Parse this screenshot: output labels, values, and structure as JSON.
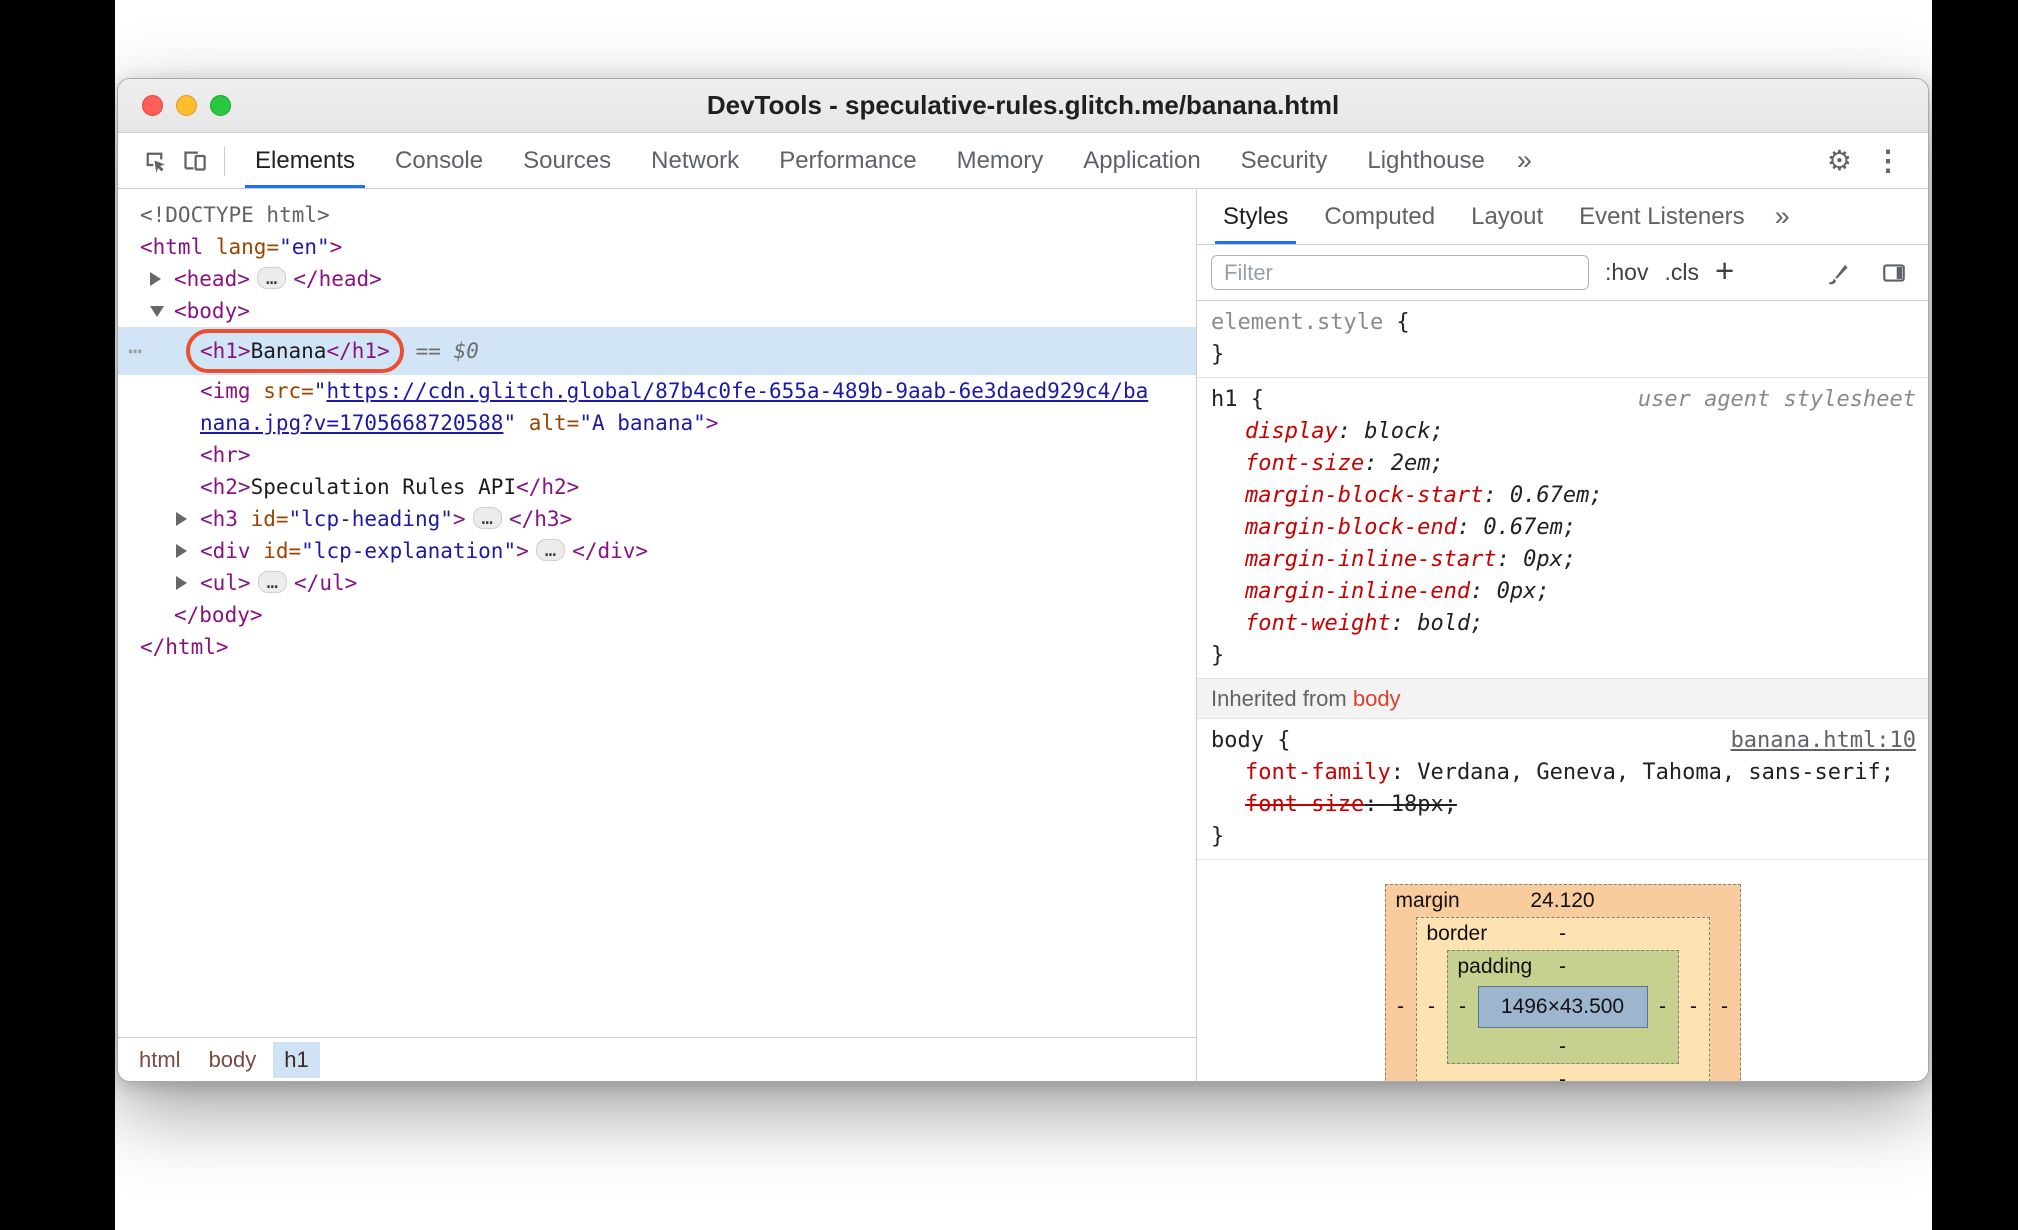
{
  "window": {
    "title": "DevTools - speculative-rules.glitch.me/banana.html"
  },
  "main_toolbar": {
    "tabs": [
      "Elements",
      "Console",
      "Sources",
      "Network",
      "Performance",
      "Memory",
      "Application",
      "Security",
      "Lighthouse"
    ],
    "more_tabs_glyph": "»",
    "gear_glyph": "⚙",
    "menu_glyph": "⋮"
  },
  "dom_tree": {
    "gutter_dots": "⋯",
    "rows": {
      "doctype": [
        {
          "c": "doctype",
          "x": "<!DOCTYPE html>"
        }
      ],
      "html_open": [
        {
          "c": "tag",
          "x": "<html"
        },
        {
          "c": "attr",
          "x": " lang="
        },
        {
          "c": "val",
          "x": "\"en\""
        },
        {
          "c": "tag",
          "x": ">"
        }
      ],
      "head": [
        {
          "c": "tag",
          "x": "<head>"
        },
        {
          "c": "pill",
          "x": "…"
        },
        {
          "c": "tag",
          "x": "</head>"
        }
      ],
      "body_open": [
        {
          "c": "tag",
          "x": "<body>"
        }
      ],
      "h1": [
        {
          "c": "tag",
          "x": "<h1>"
        },
        {
          "c": "text",
          "x": "Banana"
        },
        {
          "c": "tag",
          "x": "</h1>"
        }
      ],
      "h1_badge": "== $0",
      "img": [
        {
          "c": "tag",
          "x": "<img "
        },
        {
          "c": "attr",
          "x": "src="
        },
        {
          "c": "val",
          "x": "\""
        },
        {
          "c": "link",
          "x": "https://cdn.glitch.global/87b4c0fe-655a-489b-9aab-6e3daed929c4/ba"
        },
        {
          "c": "br",
          "x": ""
        },
        {
          "c": "link",
          "x": "nana.jpg?v=1705668720588"
        },
        {
          "c": "val",
          "x": "\""
        },
        {
          "c": "attr",
          "x": " alt="
        },
        {
          "c": "val",
          "x": "\"A banana\""
        },
        {
          "c": "tag",
          "x": ">"
        }
      ],
      "hr": [
        {
          "c": "tag",
          "x": "<hr>"
        }
      ],
      "h2": [
        {
          "c": "tag",
          "x": "<h2>"
        },
        {
          "c": "text",
          "x": "Speculation Rules API"
        },
        {
          "c": "tag",
          "x": "</h2>"
        }
      ],
      "h3": [
        {
          "c": "tag",
          "x": "<h3"
        },
        {
          "c": "attr",
          "x": " id="
        },
        {
          "c": "val",
          "x": "\"lcp-heading\""
        },
        {
          "c": "tag",
          "x": ">"
        },
        {
          "c": "pill",
          "x": "…"
        },
        {
          "c": "tag",
          "x": "</h3>"
        }
      ],
      "div": [
        {
          "c": "tag",
          "x": "<div"
        },
        {
          "c": "attr",
          "x": " id="
        },
        {
          "c": "val",
          "x": "\"lcp-explanation\""
        },
        {
          "c": "tag",
          "x": ">"
        },
        {
          "c": "pill",
          "x": "…"
        },
        {
          "c": "tag",
          "x": "</div>"
        }
      ],
      "ul": [
        {
          "c": "tag",
          "x": "<ul>"
        },
        {
          "c": "pill",
          "x": "…"
        },
        {
          "c": "tag",
          "x": "</ul>"
        }
      ],
      "body_close": [
        {
          "c": "tag",
          "x": "</body>"
        }
      ],
      "html_close": [
        {
          "c": "tag",
          "x": "</html>"
        }
      ]
    },
    "breadcrumbs": [
      "html",
      "body",
      "h1"
    ]
  },
  "styles_panel": {
    "tabs": [
      "Styles",
      "Computed",
      "Layout",
      "Event Listeners"
    ],
    "more_tabs_glyph": "»",
    "filter_placeholder": "Filter",
    "pseudo_toggle": ":hov",
    "class_toggle": ".cls",
    "plus_glyph": "+",
    "element_style": {
      "open": [
        {
          "c": "sel-gray",
          "x": "element.style"
        },
        {
          "c": "plain",
          "x": " {"
        }
      ],
      "close": "}"
    },
    "h1_rule": {
      "open": [
        {
          "c": "plain",
          "x": "h1 {"
        }
      ],
      "origin": "user agent stylesheet",
      "lines": [
        [
          {
            "c": "prop",
            "x": "display"
          },
          {
            "c": "plain",
            "x": ": "
          },
          {
            "c": "pval",
            "x": "block;"
          }
        ],
        [
          {
            "c": "prop",
            "x": "font-size"
          },
          {
            "c": "plain",
            "x": ": "
          },
          {
            "c": "pval",
            "x": "2em;"
          }
        ],
        [
          {
            "c": "prop",
            "x": "margin-block-start"
          },
          {
            "c": "plain",
            "x": ": "
          },
          {
            "c": "pval",
            "x": "0.67em;"
          }
        ],
        [
          {
            "c": "prop",
            "x": "margin-block-end"
          },
          {
            "c": "plain",
            "x": ": "
          },
          {
            "c": "pval",
            "x": "0.67em;"
          }
        ],
        [
          {
            "c": "prop",
            "x": "margin-inline-start"
          },
          {
            "c": "plain",
            "x": ": "
          },
          {
            "c": "pval",
            "x": "0px;"
          }
        ],
        [
          {
            "c": "prop",
            "x": "margin-inline-end"
          },
          {
            "c": "plain",
            "x": ": "
          },
          {
            "c": "pval",
            "x": "0px;"
          }
        ],
        [
          {
            "c": "prop",
            "x": "font-weight"
          },
          {
            "c": "plain",
            "x": ": "
          },
          {
            "c": "pval",
            "x": "bold;"
          }
        ]
      ],
      "close": "}"
    },
    "inherited_from": {
      "prefix": "Inherited from ",
      "node": "body"
    },
    "body_rule": {
      "open": [
        {
          "c": "plain",
          "x": "body {"
        }
      ],
      "source_link": "banana.html:10",
      "lines": [
        [
          {
            "c": "prop",
            "x": "font-family"
          },
          {
            "c": "plain",
            "x": ": "
          },
          {
            "c": "pval",
            "x": "Verdana, Geneva, Tahoma, sans-serif;"
          }
        ],
        [
          {
            "c": "prop",
            "x": "font-size"
          },
          {
            "c": "plain",
            "x": ": "
          },
          {
            "c": "pval",
            "x": "18px;"
          }
        ]
      ],
      "close": "}"
    },
    "box_model": {
      "margin": {
        "label": "margin",
        "top": "24.120",
        "right": "-",
        "bottom": "-",
        "left": "-"
      },
      "border": {
        "label": "border",
        "top": "-",
        "right": "-",
        "bottom": "-",
        "left": "-"
      },
      "padding": {
        "label": "padding",
        "top": "-",
        "right": "-",
        "bottom": "-",
        "left": "-"
      },
      "content": "1496×43.500"
    }
  },
  "colors": {
    "accent_blue": "#1a73e8",
    "selection_blue": "#d2e5f7",
    "annotation_orange": "#e8502f",
    "tag_purple": "#881280",
    "attr_orange": "#994500",
    "value_blue": "#1a1aa6",
    "property_red": "#c80000",
    "margin_fill": "#f9cc9d",
    "border_fill": "#fde3b1",
    "padding_fill": "#c6d08f",
    "content_fill": "#9db6ce"
  }
}
